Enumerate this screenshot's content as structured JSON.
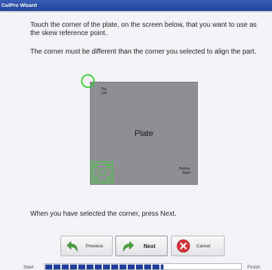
{
  "window": {
    "title": "CutPro Wizard"
  },
  "instructions": {
    "line1": "Touch the corner of the plate, on the screen below, that you want to use as the skew reference point.",
    "line2": "The corner must be different than the corner you selected to align the part.",
    "footer": "When you have selected the corner, press Next."
  },
  "plate": {
    "label": "Plate",
    "corner_top_left": "Top Left",
    "corner_bottom_right": "Bottom Right",
    "fill_color": "#8e8e94",
    "highlight_color": "#3ccf34"
  },
  "buttons": {
    "previous": "Previous",
    "next": "Next",
    "cancel": "Cancel"
  },
  "icons": {
    "previous": "arrow-back-icon",
    "next": "arrow-forward-icon",
    "cancel": "cancel-x-icon"
  },
  "progress": {
    "start": "Start",
    "finish": "Finish",
    "fraction": 0.6
  }
}
